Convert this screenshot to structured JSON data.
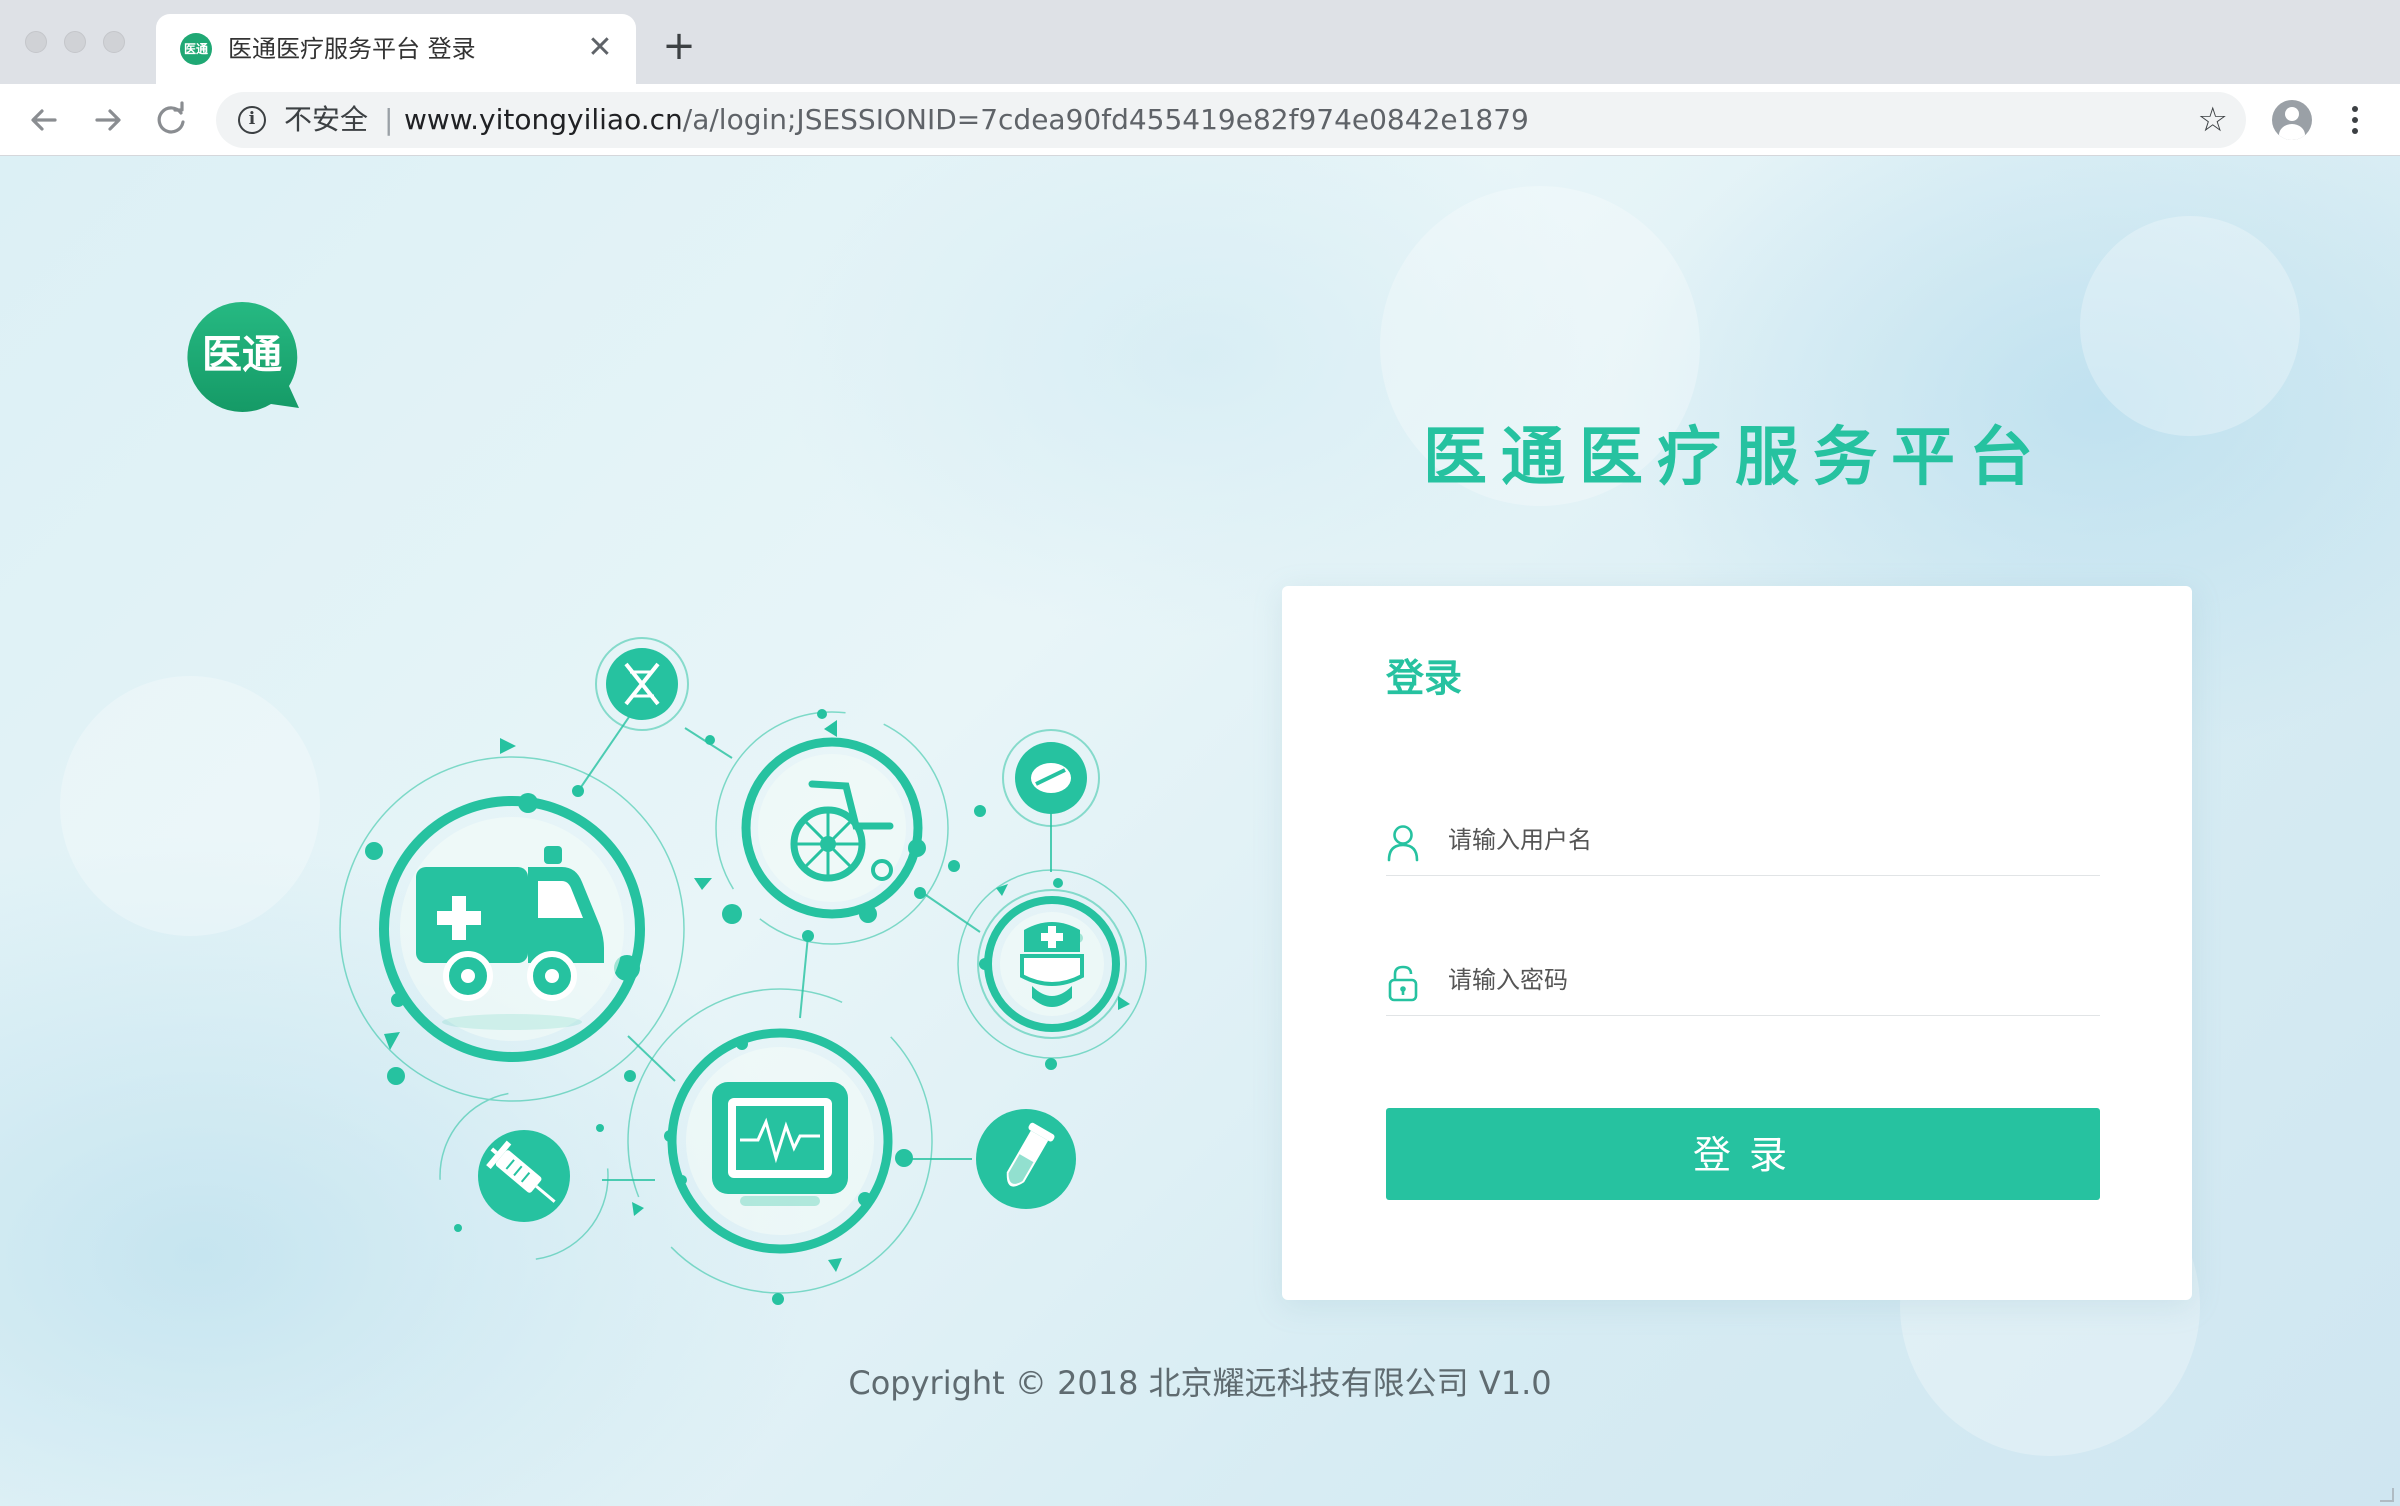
{
  "browser": {
    "tab_title": "医通医疗服务平台 登录",
    "tab_favicon_text": "医通",
    "new_tab_symbol": "+",
    "close_symbol": "✕",
    "security_label": "不安全",
    "url_host": "www.yitongyiliao.cn",
    "url_path": "/a/login;JSESSIONID=7cdea90fd455419e82f974e0842e1879",
    "icons": [
      "back-arrow-icon",
      "forward-arrow-icon",
      "reload-icon",
      "info-icon",
      "star-icon",
      "profile-icon",
      "more-menu-icon"
    ]
  },
  "page": {
    "logo_text": "医通",
    "platform_title": "医通医疗服务平台",
    "accent_color": "#26c2a0",
    "login": {
      "title": "登录",
      "username_placeholder": "请输入用户名",
      "password_placeholder": "请输入密码",
      "button_label": "登录"
    },
    "copyright": "Copyright © 2018 北京耀远科技有限公司 V1.0"
  }
}
